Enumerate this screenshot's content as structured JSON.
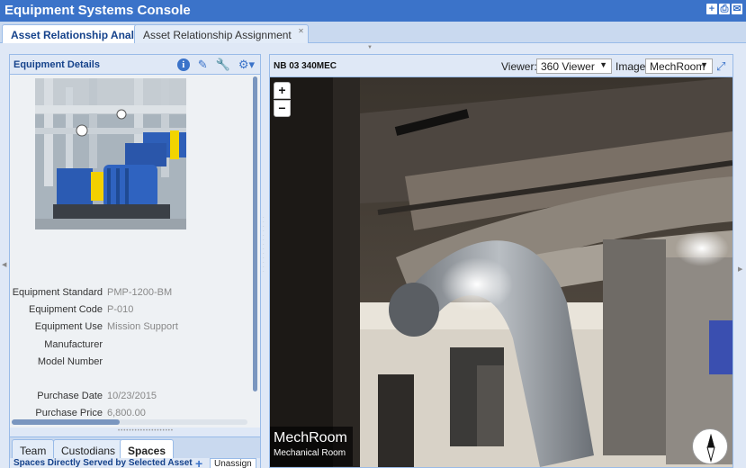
{
  "app": {
    "title": "Equipment Systems Console"
  },
  "tabs": [
    {
      "label": "Asset Relationship Analysis",
      "active": true
    },
    {
      "label": "Asset Relationship Assignment",
      "active": false
    }
  ],
  "equipment_details": {
    "title": "Equipment Details",
    "fields": [
      {
        "label": "Equipment Standard",
        "value": "PMP-1200-BM"
      },
      {
        "label": "Equipment Code",
        "value": "P-010"
      },
      {
        "label": "Equipment Use",
        "value": "Mission Support"
      },
      {
        "label": "Manufacturer",
        "value": ""
      },
      {
        "label": "Model Number",
        "value": ""
      },
      {
        "label": "Purchase Date",
        "value": "10/23/2015"
      },
      {
        "label": "Purchase Price",
        "value": "6,800.00"
      }
    ]
  },
  "bottom_tabs": [
    {
      "label": "Team",
      "active": false
    },
    {
      "label": "Custodians",
      "active": false
    },
    {
      "label": "Spaces",
      "active": true
    }
  ],
  "spaces": {
    "section_title": "Spaces Directly Served by Selected Asset",
    "unassign_label": "Unassign"
  },
  "viewer_panel": {
    "location": "NB 03 340MEC",
    "viewer_label": "Viewer:",
    "viewer_selected": "360 Viewer",
    "image_label": "Image",
    "image_selected": "MechRoom",
    "zoom_in": "+",
    "zoom_out": "−",
    "caption_title": "MechRoom",
    "caption_subtitle": "Mechanical Room"
  },
  "colors": {
    "header_blue": "#3b73c9",
    "panel_border": "#99bbe8",
    "panel_header": "#dfe8f6"
  }
}
